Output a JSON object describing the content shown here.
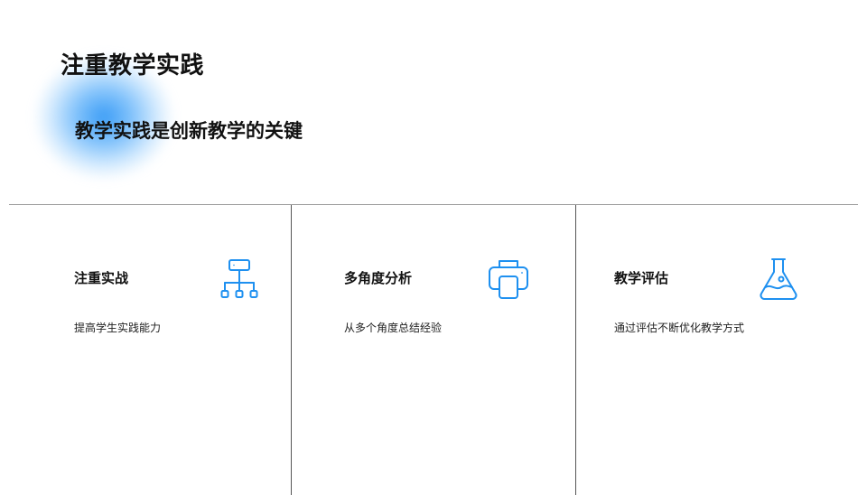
{
  "slide": {
    "title": "注重教学实践",
    "subtitle": "教学实践是创新教学的关键"
  },
  "colors": {
    "accent": "#1e90f0",
    "glow": "#3a9ff5",
    "divider": "#9a9a9a"
  },
  "cards": [
    {
      "title": "注重实战",
      "description": "提高学生实践能力",
      "icon": "org-chart-icon"
    },
    {
      "title": "多角度分析",
      "description": "从多个角度总结经验",
      "icon": "printer-icon"
    },
    {
      "title": "教学评估",
      "description": "通过评估不断优化教学方式",
      "icon": "flask-icon"
    }
  ]
}
